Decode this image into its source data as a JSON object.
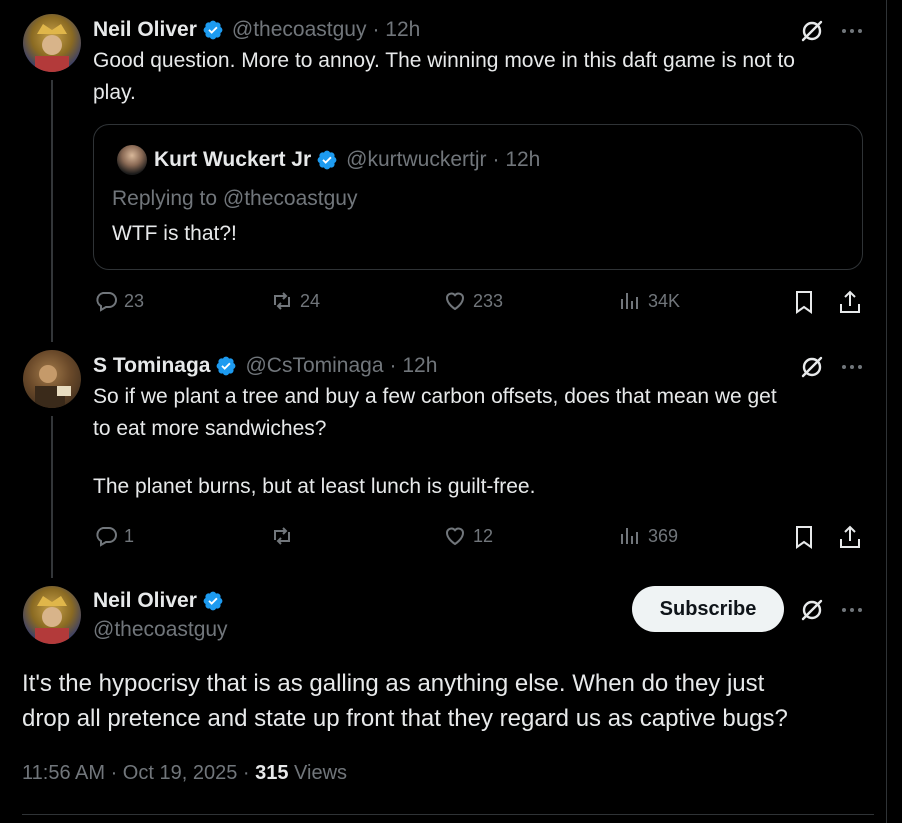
{
  "tweets": [
    {
      "name": "Neil Oliver",
      "handle": "@thecoastguy",
      "time": "· 12h",
      "text_lines": [
        "Good question. More to annoy. The winning move in this daft game is not to",
        "play."
      ],
      "actions": {
        "replies": "23",
        "reposts": "24",
        "likes": "233",
        "views": "34K"
      },
      "quote": {
        "name": "Kurt Wuckert Jr",
        "handle": "@kurtwuckertjr",
        "time": "· 12h",
        "replying": "Replying to @thecoastguy",
        "text": "WTF is that?!"
      }
    },
    {
      "name": "S Tominaga",
      "handle": "@CsTominaga",
      "time": "· 12h",
      "text_lines": [
        "So if we plant a tree and buy a few carbon offsets, does that mean we get",
        "to eat more sandwiches?",
        "",
        "The planet burns, but at least lunch is guilt-free."
      ],
      "actions": {
        "replies": "1",
        "reposts": "",
        "likes": "12",
        "views": "369"
      }
    }
  ],
  "main_tweet": {
    "name": "Neil Oliver",
    "handle": "@thecoastguy",
    "subscribe_label": "Subscribe",
    "text_lines": [
      "It's the hypocrisy that is as galling as anything else. When do they just",
      "drop all pretence and state up front that they regard us as captive bugs?"
    ],
    "time": "11:56 AM · Oct 19, 2025 ·",
    "views_count": "315",
    "views_label": "Views"
  },
  "colors": {
    "background": "#000000",
    "text": "#e7e9ea",
    "muted": "#71767b",
    "verified": "#1d9bf0",
    "border": "#2f3336"
  },
  "icons": [
    "verified-badge-icon",
    "grok-icon",
    "more-icon",
    "reply-icon",
    "repost-icon",
    "like-icon",
    "views-icon",
    "bookmark-icon",
    "share-icon"
  ]
}
